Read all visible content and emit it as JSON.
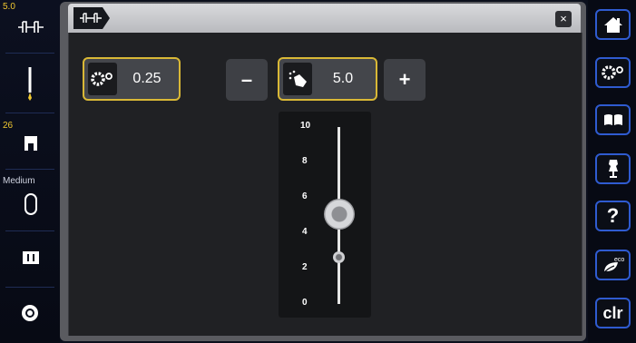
{
  "left_rail": {
    "top_value": "5.0",
    "presser_foot_number": "26",
    "foot_pressure_label": "Medium",
    "icons": [
      "stitch-width-icon",
      "needle-icon",
      "presser-foot-icon",
      "bobbin-icon",
      "feed-dog-icon",
      "tension-icon"
    ]
  },
  "title_bar": {
    "close_label": "×",
    "tab_icon": "stitch-width-icon"
  },
  "controls": {
    "balance_value": "0.25",
    "width_value": "5.0",
    "minus_label": "–",
    "plus_label": "+",
    "balance_icon": "gear-icon",
    "width_icon": "hand-pointer-icon"
  },
  "slider": {
    "ticks": [
      "10",
      "8",
      "6",
      "4",
      "2",
      "0"
    ],
    "current_value": 5.0,
    "default_value": 2.0,
    "max": 10
  },
  "right_rail": {
    "buttons": [
      "home-icon",
      "setup-icon",
      "tutorial-icon",
      "sewing-consultant-icon",
      "help-icon",
      "eco-icon"
    ],
    "clr_label": "clr",
    "help_label": "?"
  },
  "colors": {
    "accent_yellow": "#d9b836",
    "rail_border_blue": "#2f5bd0"
  }
}
